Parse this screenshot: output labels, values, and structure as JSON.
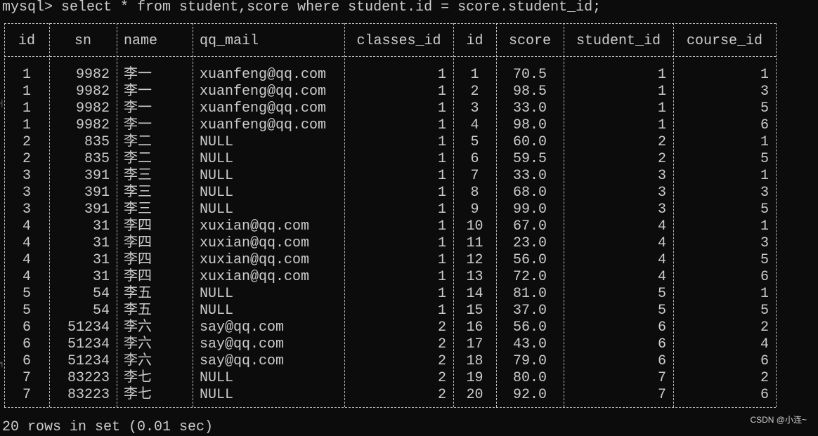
{
  "terminal": {
    "prompt": "mysql>",
    "command": "select * from student,score where student.id = score.student_id;",
    "footer": "20 rows in set (0.01 sec)",
    "watermark": "CSDN @小连~"
  },
  "table": {
    "columns": [
      "id",
      "sn",
      "name",
      "qq_mail",
      "classes_id",
      "id",
      "score",
      "student_id",
      "course_id"
    ],
    "rows": [
      [
        "1",
        "9982",
        "李一",
        "xuanfeng@qq.com",
        "1",
        "1",
        "70.5",
        "1",
        "1"
      ],
      [
        "1",
        "9982",
        "李一",
        "xuanfeng@qq.com",
        "1",
        "2",
        "98.5",
        "1",
        "3"
      ],
      [
        "1",
        "9982",
        "李一",
        "xuanfeng@qq.com",
        "1",
        "3",
        "33.0",
        "1",
        "5"
      ],
      [
        "1",
        "9982",
        "李一",
        "xuanfeng@qq.com",
        "1",
        "4",
        "98.0",
        "1",
        "6"
      ],
      [
        "2",
        "835",
        "李二",
        "NULL",
        "1",
        "5",
        "60.0",
        "2",
        "1"
      ],
      [
        "2",
        "835",
        "李二",
        "NULL",
        "1",
        "6",
        "59.5",
        "2",
        "5"
      ],
      [
        "3",
        "391",
        "李三",
        "NULL",
        "1",
        "7",
        "33.0",
        "3",
        "1"
      ],
      [
        "3",
        "391",
        "李三",
        "NULL",
        "1",
        "8",
        "68.0",
        "3",
        "3"
      ],
      [
        "3",
        "391",
        "李三",
        "NULL",
        "1",
        "9",
        "99.0",
        "3",
        "5"
      ],
      [
        "4",
        "31",
        "李四",
        "xuxian@qq.com",
        "1",
        "10",
        "67.0",
        "4",
        "1"
      ],
      [
        "4",
        "31",
        "李四",
        "xuxian@qq.com",
        "1",
        "11",
        "23.0",
        "4",
        "3"
      ],
      [
        "4",
        "31",
        "李四",
        "xuxian@qq.com",
        "1",
        "12",
        "56.0",
        "4",
        "5"
      ],
      [
        "4",
        "31",
        "李四",
        "xuxian@qq.com",
        "1",
        "13",
        "72.0",
        "4",
        "6"
      ],
      [
        "5",
        "54",
        "李五",
        "NULL",
        "1",
        "14",
        "81.0",
        "5",
        "1"
      ],
      [
        "5",
        "54",
        "李五",
        "NULL",
        "1",
        "15",
        "37.0",
        "5",
        "5"
      ],
      [
        "6",
        "51234",
        "李六",
        "say@qq.com",
        "2",
        "16",
        "56.0",
        "6",
        "2"
      ],
      [
        "6",
        "51234",
        "李六",
        "say@qq.com",
        "2",
        "17",
        "43.0",
        "6",
        "4"
      ],
      [
        "6",
        "51234",
        "李六",
        "say@qq.com",
        "2",
        "18",
        "79.0",
        "6",
        "6"
      ],
      [
        "7",
        "83223",
        "李七",
        "NULL",
        "2",
        "19",
        "80.0",
        "7",
        "2"
      ],
      [
        "7",
        "83223",
        "李七",
        "NULL",
        "2",
        "20",
        "92.0",
        "7",
        "6"
      ]
    ]
  }
}
